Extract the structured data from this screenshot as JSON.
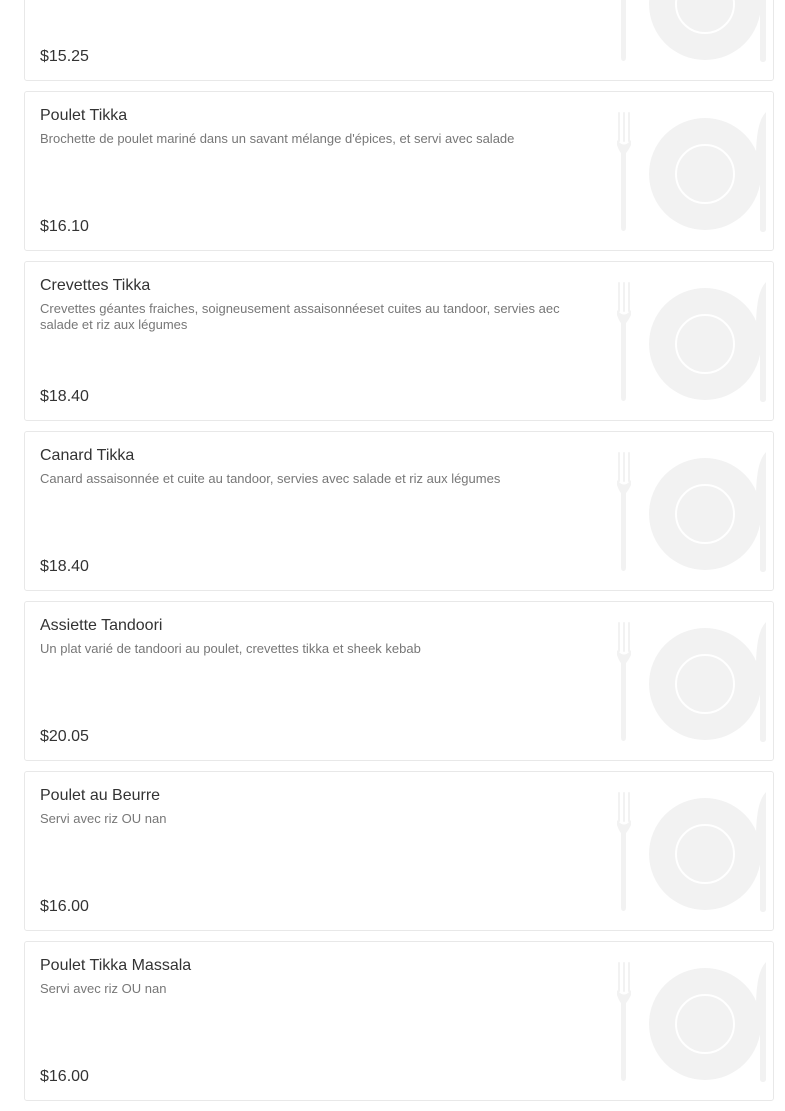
{
  "menu": {
    "currency_symbol": "$",
    "placeholder_icon": "plate-fork-knife-icon",
    "placeholder_color": "#f2f2f2",
    "items": [
      {
        "name": "",
        "description": "",
        "price": "$15.25"
      },
      {
        "name": "Poulet Tikka",
        "description": "Brochette de poulet mariné dans un savant mélange d'épices, et servi avec salade",
        "price": "$16.10"
      },
      {
        "name": "Crevettes Tikka",
        "description": "Crevettes géantes fraiches, soigneusement assaisonnéeset cuites au tandoor, servies aec salade et riz aux légumes",
        "price": "$18.40"
      },
      {
        "name": "Canard Tikka",
        "description": "Canard assaisonnée et cuite au tandoor, servies avec salade et riz aux légumes",
        "price": "$18.40"
      },
      {
        "name": "Assiette Tandoori",
        "description": "Un plat varié de tandoori au poulet, crevettes tikka et sheek kebab",
        "price": "$20.05"
      },
      {
        "name": "Poulet au Beurre",
        "description": "Servi avec riz OU nan",
        "price": "$16.00"
      },
      {
        "name": "Poulet Tikka Massala",
        "description": "Servi avec riz OU nan",
        "price": "$16.00"
      }
    ]
  }
}
